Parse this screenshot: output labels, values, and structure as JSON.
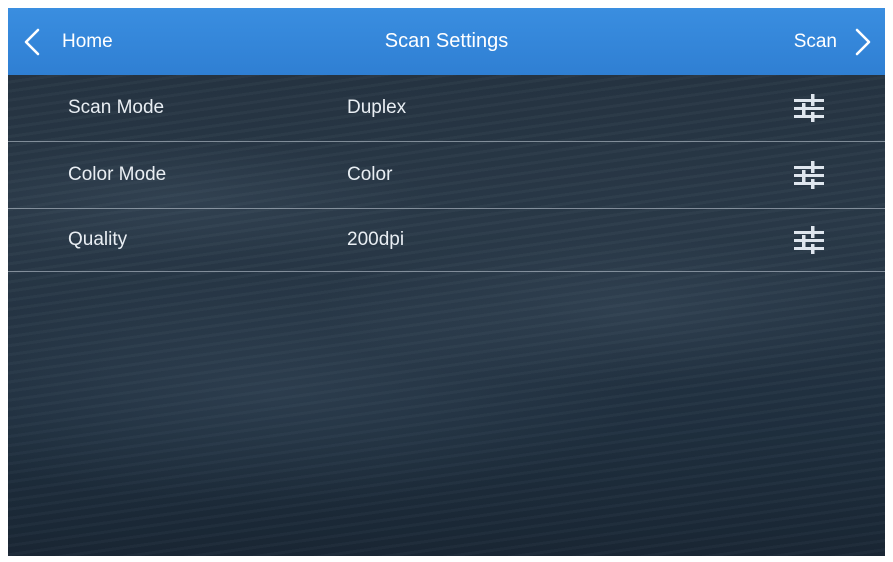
{
  "header": {
    "back_label": "Home",
    "title": "Scan Settings",
    "next_label": "Scan",
    "background_color": "#2f7fd3"
  },
  "settings": [
    {
      "name": "Scan Mode",
      "value": "Duplex",
      "icon": "sliders-icon"
    },
    {
      "name": "Color Mode",
      "value": "Color",
      "icon": "sliders-icon"
    },
    {
      "name": "Quality",
      "value": "200dpi",
      "icon": "sliders-icon"
    }
  ]
}
